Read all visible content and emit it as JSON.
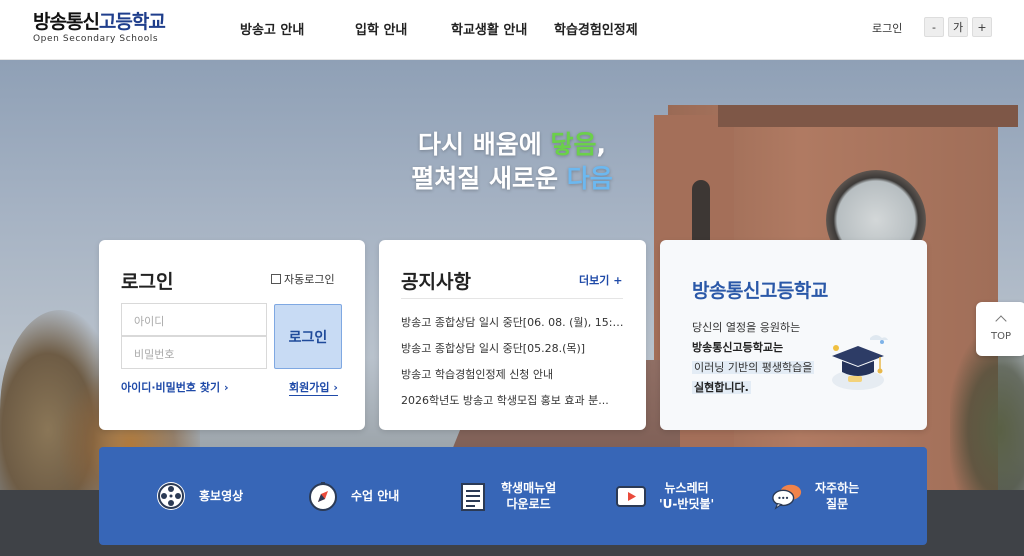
{
  "header": {
    "logo_title_a": "방송통신",
    "logo_title_b": "고등학교",
    "logo_sub": "Open Secondary Schools",
    "nav": [
      "방송고 안내",
      "입학 안내",
      "학교생활 안내",
      "학습경험인정제"
    ],
    "login_label": "로그인",
    "font_minus": "-",
    "font_label": "가",
    "font_plus": "+"
  },
  "hero": {
    "line1_a": "다시 배움에 ",
    "line1_b": "닿음",
    "line1_c": ",",
    "line2_a": "펼쳐질 새로운 ",
    "line2_b": "다음"
  },
  "login_card": {
    "title": "로그인",
    "auto_login": "자동로그인",
    "id_placeholder": "아이디",
    "pw_placeholder": "비밀번호",
    "button": "로그인",
    "find_link": "아이디·비밀번호 찾기",
    "join_link": "회원가입"
  },
  "notice_card": {
    "title": "공지사항",
    "more": "더보기",
    "items": [
      "방송고 종합상담 일시 중단[06. 08. (월), 15:0...",
      "방송고 종합상담 일시 중단[05.28.(목)]",
      "방송고 학습경험인정제 신청 안내",
      "2026학년도 방송고 학생모집 홍보 효과 분..."
    ]
  },
  "promo_card": {
    "title": "방송통신고등학교",
    "line1": "당신의 열정을 응원하는",
    "line2": "방송통신고등학교는",
    "line3": "이러닝 기반의 평생학습을",
    "line4": "실현합니다."
  },
  "quickbar": {
    "items": [
      {
        "label": "홍보영상",
        "icon": "film-reel-icon"
      },
      {
        "label": "수업 안내",
        "icon": "compass-icon"
      },
      {
        "label": "학생매뉴얼\n다운로드",
        "icon": "document-icon"
      },
      {
        "label": "뉴스레터\n'U-반딧불'",
        "icon": "play-icon"
      },
      {
        "label": "자주하는\n질문",
        "icon": "chat-bubbles-icon"
      }
    ]
  },
  "top_button": "TOP",
  "colors": {
    "brand_blue": "#3766b7",
    "accent_green": "#6bd04a",
    "accent_sky": "#6cb8f0"
  }
}
